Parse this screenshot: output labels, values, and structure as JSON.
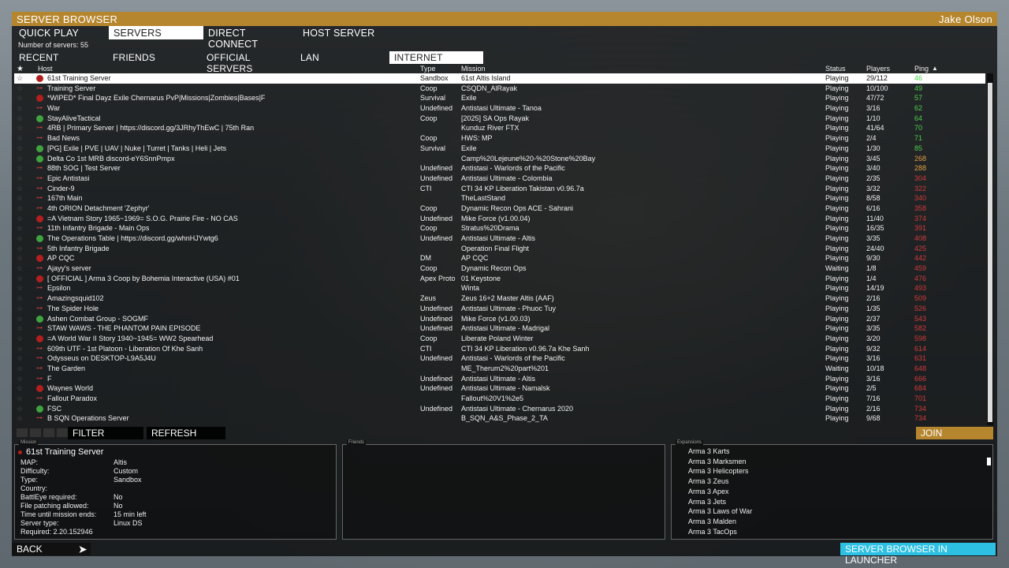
{
  "title": "SERVER BROWSER",
  "user": "Jake Olson",
  "main_tabs": [
    {
      "label": "QUICK PLAY",
      "active": false
    },
    {
      "label": "SERVERS",
      "active": true
    },
    {
      "label": "DIRECT CONNECT",
      "active": false
    },
    {
      "label": "HOST SERVER",
      "active": false
    }
  ],
  "server_count": "Number of servers: 55",
  "filter_tabs": [
    {
      "label": "RECENT",
      "active": false
    },
    {
      "label": "FRIENDS",
      "active": false
    },
    {
      "label": "OFFICIAL SERVERS",
      "active": false
    },
    {
      "label": "LAN",
      "active": false
    },
    {
      "label": "INTERNET",
      "active": true
    }
  ],
  "columns": {
    "host": "Host",
    "type": "Type",
    "mission": "Mission",
    "status": "Status",
    "players": "Players",
    "ping": "Ping",
    "sort_indicator": "▲"
  },
  "colors": {
    "accent": "#b5862d",
    "launcher": "#2ec0e3",
    "ping_good": "#4cd04c",
    "ping_mid": "#e0a040",
    "ping_bad": "#d23a3a"
  },
  "servers": [
    {
      "icon": "red",
      "host": "61st Training Server",
      "type": "Sandbox",
      "mission": "61st Altis Island",
      "status": "Playing",
      "players": "29/112",
      "ping": "46",
      "ping_level": "good"
    },
    {
      "icon": "key",
      "host": "Training Server",
      "type": "Coop",
      "mission": "CSQDN_AlRayak",
      "status": "Playing",
      "players": "10/100",
      "ping": "49",
      "ping_level": "good"
    },
    {
      "icon": "red",
      "host": "*WIPED* Final Dayz Exile Chernarus PvP|Missions|Zombies|Bases|F",
      "type": "Survival",
      "mission": "Exile",
      "status": "Playing",
      "players": "47/72",
      "ping": "57",
      "ping_level": "good"
    },
    {
      "icon": "key",
      "host": "War",
      "type": "Undefined",
      "mission": "Antistasi Ultimate - Tanoa",
      "status": "Playing",
      "players": "3/16",
      "ping": "62",
      "ping_level": "good"
    },
    {
      "icon": "green",
      "host": "StayAliveTactical",
      "type": "Coop",
      "mission": "[2025] SA Ops Rayak",
      "status": "Playing",
      "players": "1/10",
      "ping": "64",
      "ping_level": "good"
    },
    {
      "icon": "key",
      "host": "4RB | Primary Server | https://discord.gg/3JRhyThEwC | 75th Ran",
      "type": "",
      "mission": "Kunduz River FTX",
      "status": "Playing",
      "players": "41/64",
      "ping": "70",
      "ping_level": "good"
    },
    {
      "icon": "key",
      "host": "Bad News",
      "type": "Coop",
      "mission": "HWS: MP",
      "status": "Playing",
      "players": "2/4",
      "ping": "71",
      "ping_level": "good"
    },
    {
      "icon": "green",
      "host": "[PG] Exile | PVE | UAV | Nuke | Turret | Tanks | Heli | Jets",
      "type": "Survival",
      "mission": "Exile",
      "status": "Playing",
      "players": "1/30",
      "ping": "85",
      "ping_level": "good"
    },
    {
      "icon": "green",
      "host": "Delta Co 1st MRB discord-eY6SnnPmpx",
      "type": "",
      "mission": "Camp%20Lejeune%20-%20Stone%20Bay",
      "status": "Playing",
      "players": "3/45",
      "ping": "268",
      "ping_level": "mid"
    },
    {
      "icon": "key",
      "host": "88th SOG | Test Server",
      "type": "Undefined",
      "mission": "Antistasi - Warlords of the Pacific",
      "status": "Playing",
      "players": "3/40",
      "ping": "288",
      "ping_level": "mid"
    },
    {
      "icon": "key",
      "host": "Epic Antistasi",
      "type": "Undefined",
      "mission": "Antistasi Ultimate - Colombia",
      "status": "Playing",
      "players": "2/35",
      "ping": "304",
      "ping_level": "bad"
    },
    {
      "icon": "key",
      "host": "Cinder-9",
      "type": "CTI",
      "mission": "CTI 34 KP Liberation Takistan v0.96.7a",
      "status": "Playing",
      "players": "3/32",
      "ping": "322",
      "ping_level": "bad"
    },
    {
      "icon": "key",
      "host": "167th Main",
      "type": "",
      "mission": "TheLastStand",
      "status": "Playing",
      "players": "8/58",
      "ping": "340",
      "ping_level": "bad"
    },
    {
      "icon": "key",
      "host": "4th ORION Detachment 'Zephyr'",
      "type": "Coop",
      "mission": "Dynamic Recon Ops ACE - Sahrani",
      "status": "Playing",
      "players": "6/16",
      "ping": "358",
      "ping_level": "bad"
    },
    {
      "icon": "red",
      "host": "=A Vietnam Story 1965~1969= S.O.G. Prairie Fire - NO CAS",
      "type": "Undefined",
      "mission": "Mike Force (v1.00.04)",
      "status": "Playing",
      "players": "11/40",
      "ping": "374",
      "ping_level": "bad"
    },
    {
      "icon": "key",
      "host": "11th Infantry Brigade - Main Ops",
      "type": "Coop",
      "mission": "Stratus%20Drama",
      "status": "Playing",
      "players": "16/35",
      "ping": "391",
      "ping_level": "bad"
    },
    {
      "icon": "green",
      "host": "The Operations Table | https://discord.gg/whnHJYwtg6",
      "type": "Undefined",
      "mission": "Antistasi Ultimate - Altis",
      "status": "Playing",
      "players": "3/35",
      "ping": "408",
      "ping_level": "bad"
    },
    {
      "icon": "key",
      "host": "5th Infantry Brigade",
      "type": "",
      "mission": "Operation Final Flight",
      "status": "Playing",
      "players": "24/40",
      "ping": "425",
      "ping_level": "bad"
    },
    {
      "icon": "red",
      "host": "AP CQC",
      "type": "DM",
      "mission": "AP CQC",
      "status": "Playing",
      "players": "9/30",
      "ping": "442",
      "ping_level": "bad"
    },
    {
      "icon": "key",
      "host": "Ajayy's server",
      "type": "Coop",
      "mission": "Dynamic Recon Ops",
      "status": "Waiting",
      "players": "1/8",
      "ping": "459",
      "ping_level": "bad"
    },
    {
      "icon": "red",
      "host": " [ OFFICIAL ] Arma 3 Coop by Bohemia Interactive (USA) #01",
      "type": "Apex Proto",
      "mission": "01 Keystone",
      "status": "Playing",
      "players": "1/4",
      "ping": "476",
      "ping_level": "bad"
    },
    {
      "icon": "key",
      "host": "Epsilon",
      "type": "",
      "mission": "Winta",
      "status": "Playing",
      "players": "14/19",
      "ping": "493",
      "ping_level": "bad"
    },
    {
      "icon": "key",
      "host": "Amazingsquid102",
      "type": "Zeus",
      "mission": "Zeus 16+2 Master Altis (AAF)",
      "status": "Playing",
      "players": "2/16",
      "ping": "509",
      "ping_level": "bad"
    },
    {
      "icon": "key",
      "host": "The Spider Hole",
      "type": "Undefined",
      "mission": "Antistasi Ultimate - Phuoc Tuy",
      "status": "Playing",
      "players": "1/35",
      "ping": "526",
      "ping_level": "bad"
    },
    {
      "icon": "green",
      "host": "Ashen Combat Group - SOGMF",
      "type": "Undefined",
      "mission": "Mike Force (v1.00.03)",
      "status": "Playing",
      "players": "2/37",
      "ping": "543",
      "ping_level": "bad"
    },
    {
      "icon": "key",
      "host": "STAW WAWS - THE PHANTOM PAIN EPISODE",
      "type": "Undefined",
      "mission": "Antistasi Ultimate - Madrigal",
      "status": "Playing",
      "players": "3/35",
      "ping": "582",
      "ping_level": "bad"
    },
    {
      "icon": "red",
      "host": "=A World War II Story 1940~1945= WW2 Spearhead",
      "type": "Coop",
      "mission": "Liberate Poland Winter",
      "status": "Playing",
      "players": "3/20",
      "ping": "598",
      "ping_level": "bad"
    },
    {
      "icon": "key",
      "host": "609th UTF - 1st Platoon - Liberation Of Khe Sanh",
      "type": "CTI",
      "mission": "CTI 34 KP Liberation v0.96.7a Khe Sanh",
      "status": "Playing",
      "players": "9/32",
      "ping": "614",
      "ping_level": "bad"
    },
    {
      "icon": "key",
      "host": "Odysseus on DESKTOP-L9A5J4U",
      "type": "Undefined",
      "mission": "Antistasi - Warlords of the Pacific",
      "status": "Playing",
      "players": "3/16",
      "ping": "631",
      "ping_level": "bad"
    },
    {
      "icon": "key",
      "host": "The Garden",
      "type": "",
      "mission": "ME_Therum2%20part%201",
      "status": "Waiting",
      "players": "10/18",
      "ping": "648",
      "ping_level": "bad"
    },
    {
      "icon": "key",
      "host": "F",
      "type": "Undefined",
      "mission": "Antistasi Ultimate - Altis",
      "status": "Playing",
      "players": "3/16",
      "ping": "666",
      "ping_level": "bad"
    },
    {
      "icon": "red",
      "host": "Waynes World",
      "type": "Undefined",
      "mission": "Antistasi Ultimate - Namalsk",
      "status": "Playing",
      "players": "2/5",
      "ping": "684",
      "ping_level": "bad"
    },
    {
      "icon": "key",
      "host": "Fallout Paradox",
      "type": "",
      "mission": "Fallout%20V1%2e5",
      "status": "Playing",
      "players": "7/16",
      "ping": "701",
      "ping_level": "bad"
    },
    {
      "icon": "green",
      "host": "FSC",
      "type": "Undefined",
      "mission": "Antistasi Ultimate - Chernarus 2020",
      "status": "Playing",
      "players": "2/16",
      "ping": "734",
      "ping_level": "bad"
    },
    {
      "icon": "key",
      "host": "B SQN Operations Server",
      "type": "",
      "mission": "B_SQN_A&S_Phase_2_TA",
      "status": "Playing",
      "players": "9/68",
      "ping": "734",
      "ping_level": "bad"
    }
  ],
  "buttons": {
    "filter": "FILTER",
    "refresh": "REFRESH",
    "join": "JOIN",
    "back": "BACK",
    "launcher": "SERVER BROWSER IN LAUNCHER"
  },
  "panels": {
    "mission_label": "Mission",
    "friends_label": "Friends",
    "expansions_label": "Expansions"
  },
  "details": {
    "name": "61st Training Server",
    "rows": [
      {
        "k": "MAP:",
        "v": "Altis"
      },
      {
        "k": "Difficulty:",
        "v": "Custom"
      },
      {
        "k": "Type:",
        "v": "Sandbox"
      },
      {
        "k": "Country:",
        "v": ""
      },
      {
        "k": "BattlEye required:",
        "v": "No"
      },
      {
        "k": "File patching allowed:",
        "v": "No"
      },
      {
        "k": "Time until mission ends:",
        "v": "15 min left"
      },
      {
        "k": "Server type:",
        "v": "Linux DS"
      }
    ],
    "required": "Required: 2.20.152946"
  },
  "expansions": [
    "Arma 3 Karts",
    "Arma 3 Marksmen",
    "Arma 3 Helicopters",
    "Arma 3 Zeus",
    "Arma 3 Apex",
    "Arma 3 Jets",
    "Arma 3 Laws of War",
    "Arma 3 Malden",
    "Arma 3 TacOps"
  ]
}
